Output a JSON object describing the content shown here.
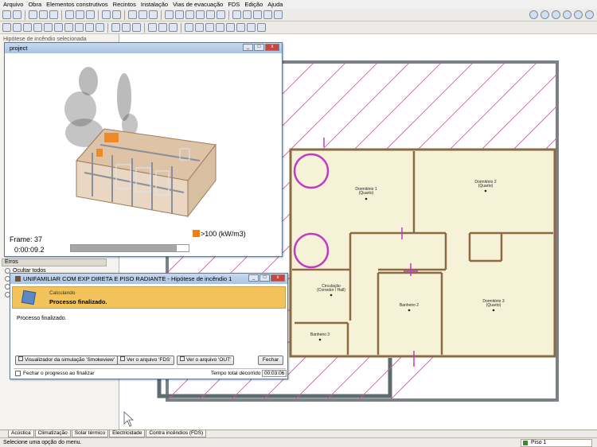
{
  "menu": [
    "Arquivo",
    "Obra",
    "Elementos construtivos",
    "Recintos",
    "Instalação",
    "Vias de evacuação",
    "FDS",
    "Edição",
    "Ajuda"
  ],
  "left_panel": {
    "title": "Hipótese de incêndio selecionada",
    "section": "Erros",
    "radios": [
      "Ocultar todos",
      "",
      "",
      ""
    ]
  },
  "project_window": {
    "title": "project",
    "frame_label": "Frame: 37",
    "time_label": "0:00:09.2",
    "legend_label": ">100 (kW/m3)",
    "legend_color": "#f08010",
    "progress": 0.9
  },
  "calc_window": {
    "title": "UNIFAMILIAR COM EXP DIRETA E PISO RADIANTE - Hipótese de incêndio 1",
    "banner_small": "Calculando",
    "banner_big": "Processo finalizado.",
    "message": "Processo finalizado.",
    "buttons": {
      "smokeview": "Visualizador da simulação 'Smokeview'",
      "fds": "Ver o arquivo 'FDS'",
      "out": "Ver o arquivo 'OUT'",
      "close": "Fechar"
    },
    "checkbox_label": "Fechar o progresso ao finalizar",
    "time_label": "Tempo total decorrido",
    "time_value": "00:03:06",
    "banner_color": "#f2c35a"
  },
  "plan": {
    "rooms": [
      {
        "name": "Dormitório 1",
        "sub": "(Quarto)"
      },
      {
        "name": "Dormitório 2",
        "sub": "(Quarto)"
      },
      {
        "name": "Circulação",
        "sub": "(Corredor / Hall)"
      },
      {
        "name": "Banheiro 2",
        "sub": ""
      },
      {
        "name": "Dormitório 3",
        "sub": "(Quarto)"
      },
      {
        "name": "Banheiro 3",
        "sub": ""
      }
    ]
  },
  "tabs": [
    "Acústica",
    "Climatização",
    "Solar térmico",
    "Electricidade",
    "Contra incêndios (FDS)"
  ],
  "status": {
    "text": "Selecione uma opção do menu.",
    "floor": "Piso 1"
  }
}
